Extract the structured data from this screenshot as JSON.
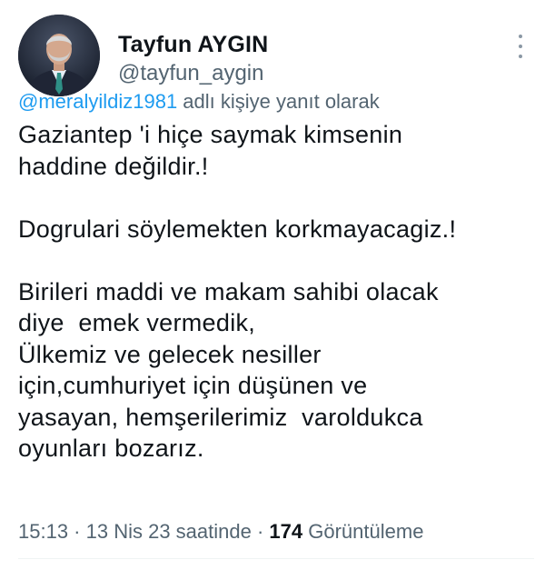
{
  "author": {
    "display_name": "Tayfun AYGIN",
    "handle": "@tayfun_aygin"
  },
  "reply_context": {
    "mention": "@meralyildiz1981",
    "suffix": " adlı kişiye yanıt olarak"
  },
  "tweet": {
    "text": "Gaziantep 'i hiçe saymak kimsenin\nhaddine değildir.!\n\nDogrulari söylemekten korkmayacagiz.!\n\nBirileri maddi ve makam sahibi olacak\ndiye  emek vermedik,\nÜlkemiz ve gelecek nesiller\niçin,cumhuriyet için düşünen ve\nyasayan, hemşerilerimiz  varoldukca\noyunları bozarız."
  },
  "meta": {
    "time": "15:13",
    "separator": " · ",
    "date": "13 Nis 23 saatinde",
    "view_count": "174",
    "view_label": " Görüntüleme"
  },
  "icons": {
    "more": "more-vertical-icon",
    "avatar": "profile-photo"
  },
  "colors": {
    "text_primary": "#0f1419",
    "text_secondary": "#536471",
    "link": "#1d9bf0"
  }
}
